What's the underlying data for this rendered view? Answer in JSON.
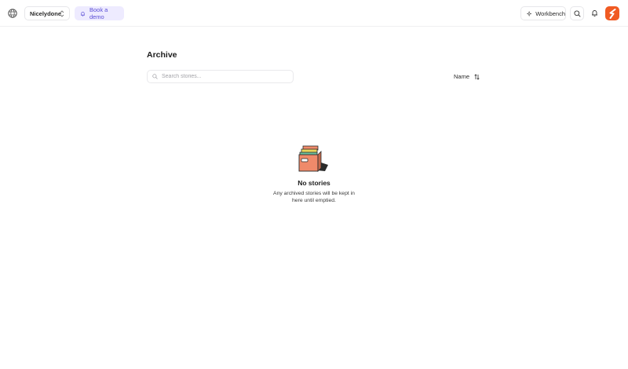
{
  "header": {
    "workspace_name": "Nicelydone",
    "demo_label": "Book a demo",
    "workbench_label": "Workbench"
  },
  "colors": {
    "accent": "#5b4fd6",
    "accent_bg": "#eeebff",
    "brand": "#f05a22"
  },
  "icons": [
    "globe-icon",
    "chevron-updown-icon",
    "bell-icon",
    "sparkle-icon",
    "search-icon",
    "notification-bell-icon",
    "brand-logo-icon",
    "sort-icon",
    "archive-box-illustration"
  ],
  "main": {
    "title": "Archive",
    "search_placeholder": "Search stories...",
    "sort_label": "Name",
    "empty_title": "No stories",
    "empty_description": "Any archived stories will be kept in here until emptied."
  }
}
